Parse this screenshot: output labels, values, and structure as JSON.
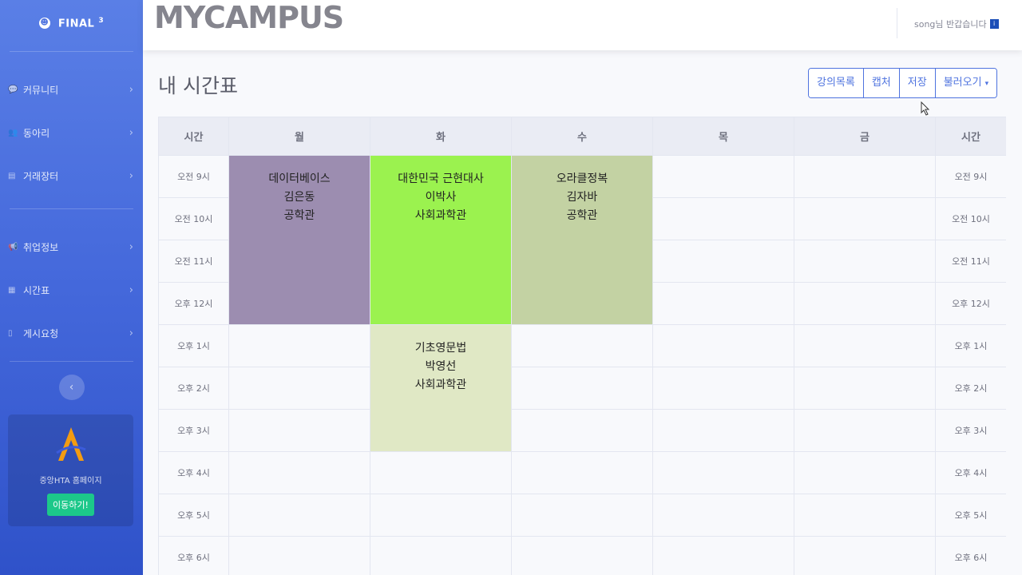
{
  "sidebar": {
    "brand": "FINAL",
    "brand_sup": "3",
    "items": [
      {
        "label": "커뮤니티",
        "icon": "comments-icon"
      },
      {
        "label": "동아리",
        "icon": "users-icon"
      },
      {
        "label": "거래장터",
        "icon": "store-icon"
      },
      {
        "label": "취업정보",
        "icon": "bullhorn-icon"
      },
      {
        "label": "시간표",
        "icon": "calendar-icon"
      },
      {
        "label": "게시요청",
        "icon": "file-icon"
      }
    ],
    "promo_text": "중앙HTA 홈페이지",
    "promo_button": "이동하기!"
  },
  "topbar": {
    "logo": "MYCAMPUS",
    "user_text": "song님 반갑습니다",
    "user_badge": "i"
  },
  "main": {
    "title": "내 시간표",
    "buttons": [
      "강의목록",
      "캡처",
      "저장",
      "불러오기"
    ]
  },
  "timetable": {
    "header_time": "시간",
    "days": [
      "월",
      "화",
      "수",
      "목",
      "금"
    ],
    "times": [
      "오전 9시",
      "오전 10시",
      "오전 11시",
      "오후 12시",
      "오후 1시",
      "오후 2시",
      "오후 3시",
      "오후 4시",
      "오후 5시",
      "오후 6시"
    ],
    "lectures": [
      {
        "name": "데이터베이스",
        "professor": "김은동",
        "room": "공학관",
        "color": "#9c8db0"
      },
      {
        "name": "대한민국 근현대사",
        "professor": "이박사",
        "room": "사회과학관",
        "color": "#9bf24f"
      },
      {
        "name": "오라클정복",
        "professor": "김자바",
        "room": "공학관",
        "color": "#c3d2a3"
      },
      {
        "name": "기초영문법",
        "professor": "박영선",
        "room": "사회과학관",
        "color": "#e0e8c5"
      }
    ]
  }
}
